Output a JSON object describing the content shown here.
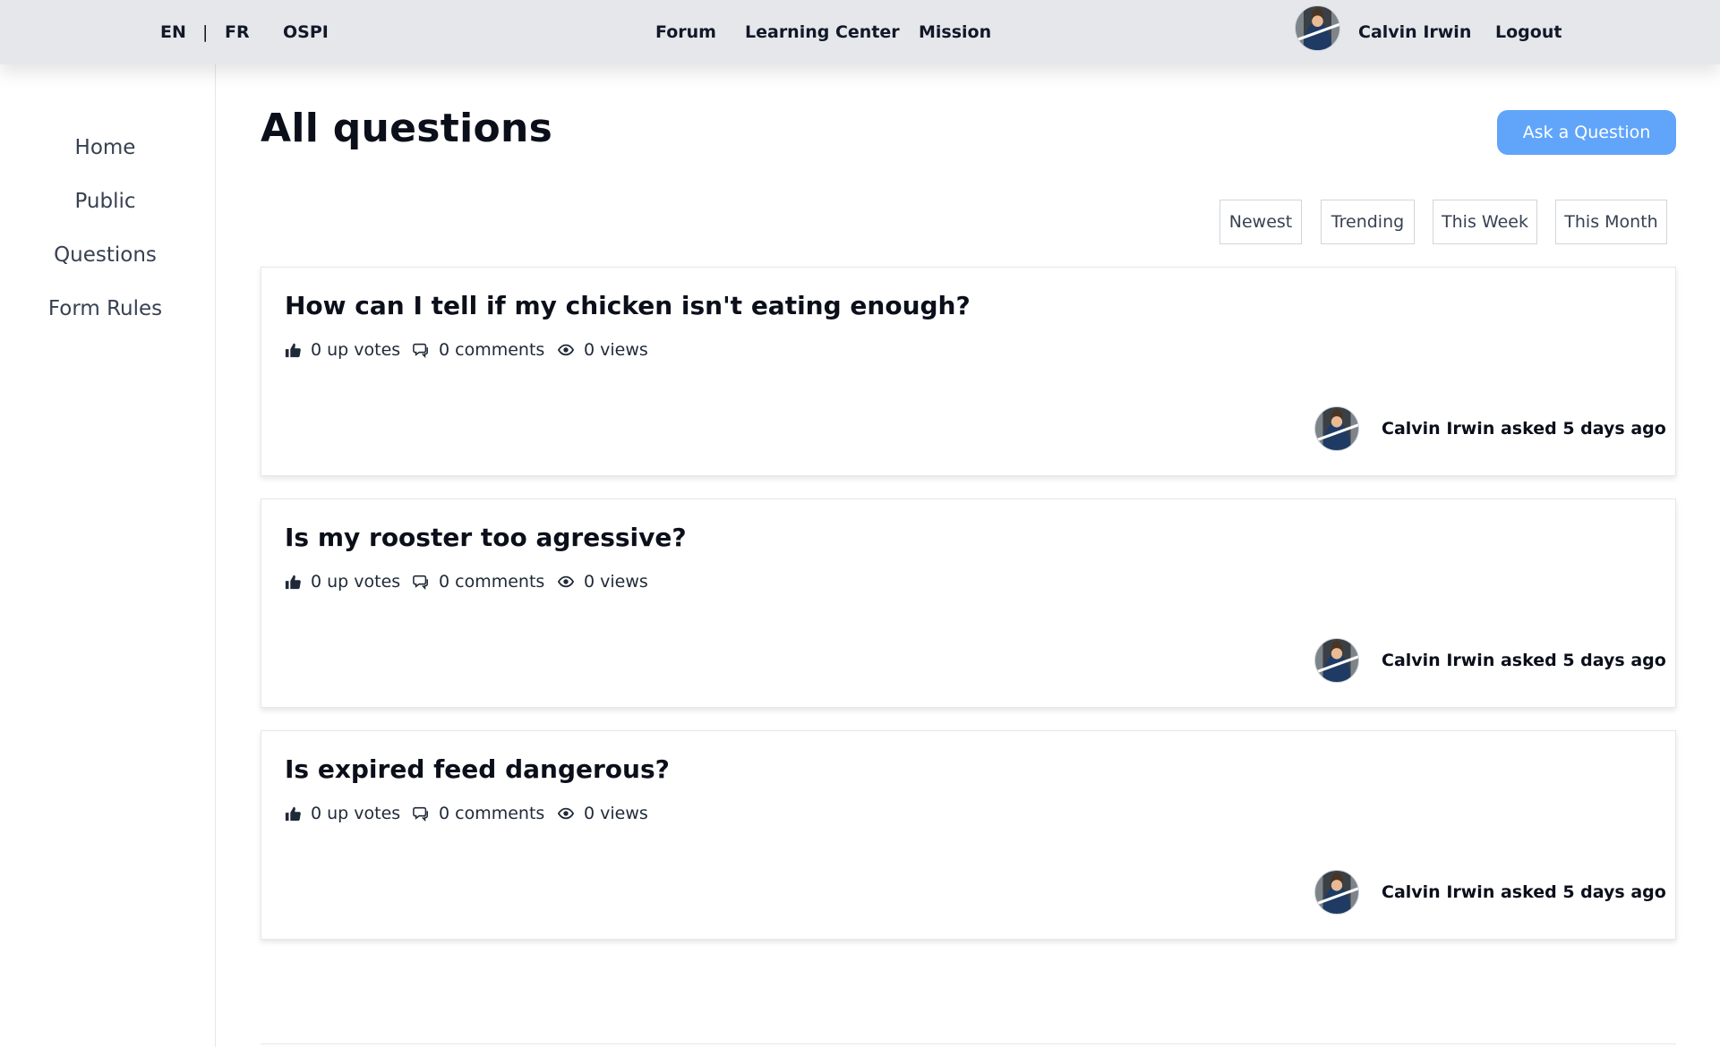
{
  "topbar": {
    "lang_en": "EN",
    "lang_sep": "|",
    "lang_fr": "FR",
    "brand": "OSPI",
    "nav": [
      "Forum",
      "Learning Center",
      "Mission"
    ],
    "user_name": "Calvin Irwin",
    "logout": "Logout"
  },
  "sidebar": {
    "items": [
      "Home",
      "Public",
      "Questions",
      "Form Rules"
    ]
  },
  "main": {
    "title": "All questions",
    "ask_button": "Ask a Question",
    "filters": [
      "Newest",
      "Trending",
      "This Week",
      "This Month"
    ]
  },
  "questions": [
    {
      "title": "How can I tell if my chicken isn't eating enough?",
      "upvotes": "0 up votes",
      "comments": "0 comments",
      "views": "0 views",
      "author": "Calvin Irwin",
      "asked": " asked 5 days ago"
    },
    {
      "title": "Is my rooster too agressive?",
      "upvotes": "0 up votes",
      "comments": "0 comments",
      "views": "0 views",
      "author": "Calvin Irwin",
      "asked": " asked 5 days ago"
    },
    {
      "title": "Is expired feed dangerous?",
      "upvotes": "0 up votes",
      "comments": "0 comments",
      "views": "0 views",
      "author": "Calvin Irwin",
      "asked": " asked 5 days ago"
    }
  ],
  "icons": {
    "upvote": "thumbs-up-icon",
    "comments": "chat-bubbles-icon",
    "views": "eye-icon"
  },
  "colors": {
    "accent": "#60a5fa",
    "topbar_bg": "#e5e7eb"
  }
}
